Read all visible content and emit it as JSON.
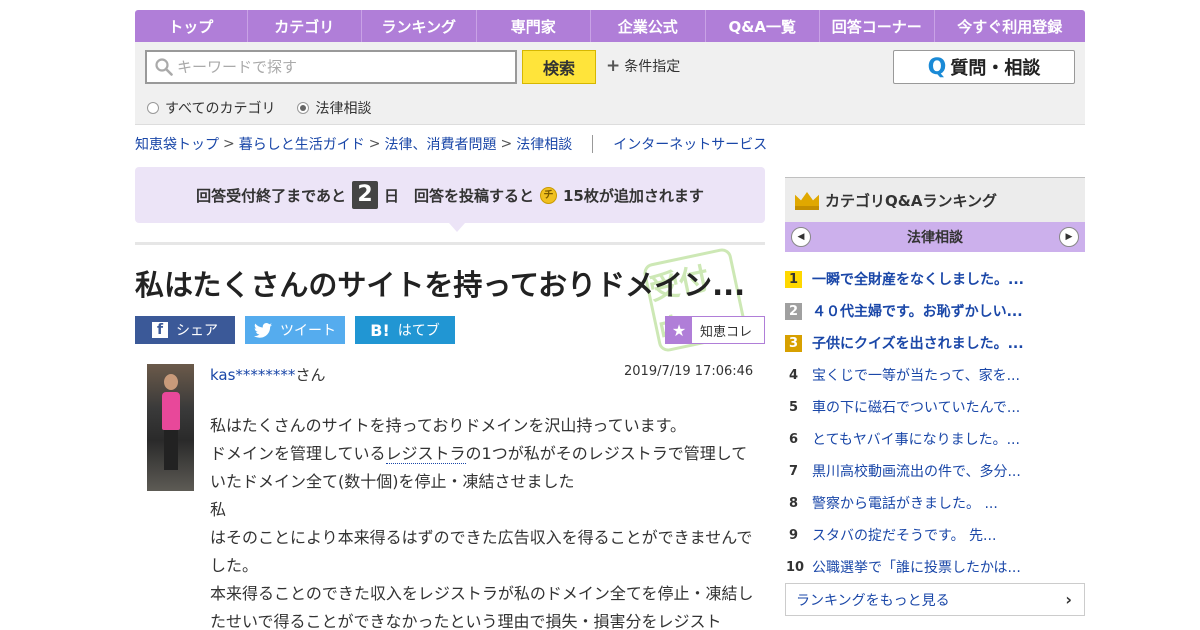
{
  "nav": [
    "トップ",
    "カテゴリ",
    "ランキング",
    "専門家",
    "企業公式",
    "Q&A一覧",
    "回答コーナー",
    "今すぐ利用登録"
  ],
  "search": {
    "placeholder": "キーワードで探す",
    "button": "検索",
    "conditions": "条件指定",
    "ask_button": "質問・相談",
    "radio_all": "すべてのカテゴリ",
    "radio_law": "法律相談"
  },
  "breadcrumb": {
    "items": [
      "知恵袋トップ",
      "暮らしと生活ガイド",
      "法律、消費者問題",
      "法律相談"
    ],
    "extra": "インターネットサービス"
  },
  "banner": {
    "pre": "回答受付終了まであと",
    "days": "2",
    "post": "日　回答を投稿すると",
    "coin": "チ",
    "reward": "15枚が追加されます"
  },
  "question": {
    "title": "私はたくさんのサイトを持っておりドメイン...",
    "stamp": "受付中",
    "user": "kas********",
    "user_suffix": "さん",
    "timestamp": "2019/7/19  17:06:46",
    "line1": "私はたくさんのサイトを持っておりドメインを沢山持っています。",
    "line2a": "ドメインを管理している",
    "line2kw": "レジストラ",
    "line2b": "の1つが私がそのレジストラで管理していたドメイン全て(数十個)を停止・凍結させました",
    "line3": "私",
    "line4": "はそのことにより本来得るはずのできた広告収入を得ることができませんでした。",
    "line5": "本来得ることのできた収入をレジストラが私のドメイン全てを停止・凍結したせいで得ることができなかったという理由で損失・損害分をレジスト"
  },
  "share": {
    "fb": "シェア",
    "tw": "ツイート",
    "hb_icon": "B!",
    "hb": "はてブ",
    "chiekore": "知恵コレ"
  },
  "ranking": {
    "title": "カテゴリQ&Aランキング",
    "category": "法律相談",
    "items": [
      {
        "no": "1",
        "text": "一瞬で全財産をなくしました。..."
      },
      {
        "no": "2",
        "text": "４０代主婦です。お恥ずかしい..."
      },
      {
        "no": "3",
        "text": "子供にクイズを出されました。..."
      },
      {
        "no": "4",
        "text": "宝くじで一等が当たって、家を..."
      },
      {
        "no": "5",
        "text": "車の下に磁石でついていたんで..."
      },
      {
        "no": "6",
        "text": "とてもヤバイ事になりました。..."
      },
      {
        "no": "7",
        "text": "黒川高校動画流出の件で、多分..."
      },
      {
        "no": "8",
        "text": "警察から電話がきました。 ..."
      },
      {
        "no": "9",
        "text": "スタバの掟だそうです。 先..."
      },
      {
        "no": "10",
        "text": "公職選挙で「誰に投票したかは..."
      }
    ],
    "more": "ランキングをもっと見る"
  }
}
